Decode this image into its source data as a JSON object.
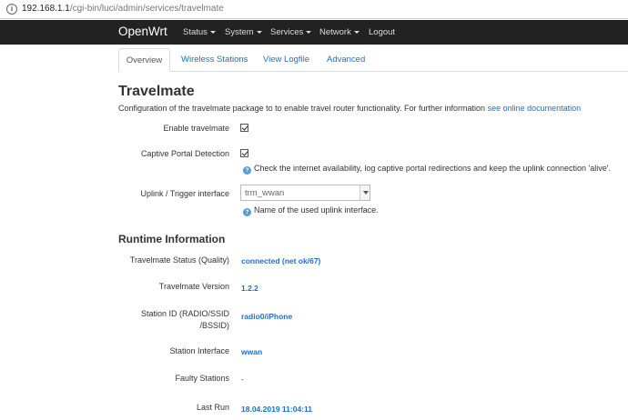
{
  "browser": {
    "info_icon": "info-icon",
    "url_host": "192.168.1.1",
    "url_path": "/cgi-bin/luci/admin/services/travelmate"
  },
  "header": {
    "brand": "OpenWrt",
    "menu": [
      {
        "label": "Status"
      },
      {
        "label": "System"
      },
      {
        "label": "Services"
      },
      {
        "label": "Network"
      },
      {
        "label": "Logout"
      }
    ]
  },
  "tabs": [
    {
      "label": "Overview",
      "active": true
    },
    {
      "label": "Wireless Stations"
    },
    {
      "label": "View Logfile"
    },
    {
      "label": "Advanced"
    }
  ],
  "page": {
    "title": "Travelmate",
    "description": "Configuration of the travelmate package to to enable travel router functionality. For further information ",
    "doc_link": "see online documentation"
  },
  "settings": {
    "enable": {
      "label": "Enable travelmate",
      "checked": true
    },
    "captive": {
      "label": "Captive Portal Detection",
      "checked": true,
      "help": "Check the internet availability, log captive portal redirections and keep the uplink connection 'alive'."
    },
    "uplink": {
      "label": "Uplink / Trigger interface",
      "value": "trm_wwan",
      "help": "Name of the used uplink interface."
    }
  },
  "runtime": {
    "title": "Runtime Information",
    "rows": [
      {
        "label": "Travelmate Status (Quality)",
        "value": "connected (net ok/67)"
      },
      {
        "label": "Travelmate Version",
        "value": "1.2.2"
      },
      {
        "label": "Station ID (RADIO/SSID /BSSID)",
        "value": "radio0/iPhone"
      },
      {
        "label": "Station Interface",
        "value": "wwan"
      },
      {
        "label": "Faulty Stations",
        "value": "-"
      },
      {
        "label": "Last Run",
        "value": "18.04.2019 11:04:11"
      }
    ]
  },
  "colors": {
    "header_bg": "#222222",
    "link": "#1a6fd0",
    "help_icon": "#5b9bd5"
  }
}
